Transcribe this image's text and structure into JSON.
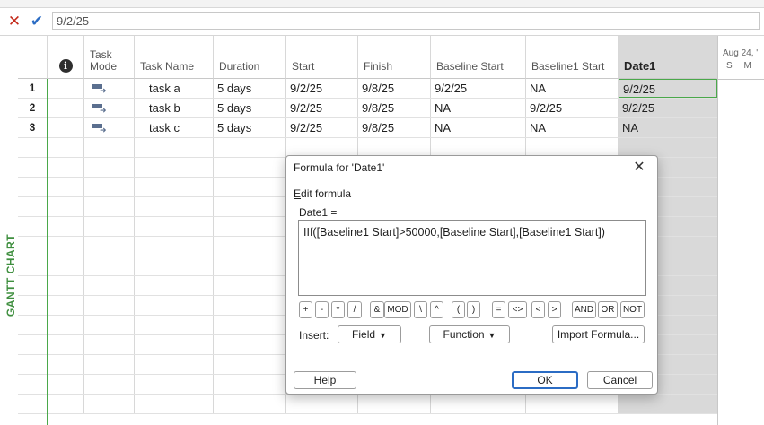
{
  "entry_bar": {
    "value": "9/2/25"
  },
  "side_label": "GANTT CHART",
  "columns": {
    "mode_line1": "Task",
    "mode_line2": "Mode",
    "task_name": "Task Name",
    "duration": "Duration",
    "start": "Start",
    "finish": "Finish",
    "baseline_start": "Baseline Start",
    "baseline1_start": "Baseline1 Start",
    "date1": "Date1"
  },
  "rows": [
    {
      "id": "1",
      "name": "task a",
      "duration": "5 days",
      "start": "9/2/25",
      "finish": "9/8/25",
      "baseline_start": "9/2/25",
      "baseline1_start": "NA",
      "date1": "9/2/25"
    },
    {
      "id": "2",
      "name": "task b",
      "duration": "5 days",
      "start": "9/2/25",
      "finish": "9/8/25",
      "baseline_start": "NA",
      "baseline1_start": "9/2/25",
      "date1": "9/2/25"
    },
    {
      "id": "3",
      "name": "task c",
      "duration": "5 days",
      "start": "9/2/25",
      "finish": "9/8/25",
      "baseline_start": "NA",
      "baseline1_start": "NA",
      "date1": "NA"
    }
  ],
  "gantt": {
    "date_label": "Aug 24, '",
    "days_label": "S M"
  },
  "dialog": {
    "title": "Formula for 'Date1'",
    "group_label_prefix": "E",
    "group_label_rest": "dit formula",
    "field_label": "Date1 =",
    "formula": "IIf([Baseline1 Start]>50000,[Baseline Start],[Baseline1 Start])",
    "operators": {
      "plus": "+",
      "minus": "-",
      "mult": "*",
      "div": "/",
      "amp": "&",
      "mod": "MOD",
      "bslash": "\\",
      "caret": "^",
      "lparen": "(",
      "rparen": ")",
      "eq": "=",
      "neq": "<>",
      "lt": "<",
      "gt": ">",
      "and": "AND",
      "or": "OR",
      "not": "NOT"
    },
    "insert_label": "Insert:",
    "field_button": "Field",
    "function_button": "Function",
    "import_button": "Import Formula...",
    "help_button": "Help",
    "ok_button": "OK",
    "cancel_button": "Cancel"
  },
  "colors": {
    "accent": "#2b6cc4",
    "cancel_red": "#c42b1c",
    "gantt_green": "#4aa84a",
    "date1_column": "#d9d9d9"
  }
}
